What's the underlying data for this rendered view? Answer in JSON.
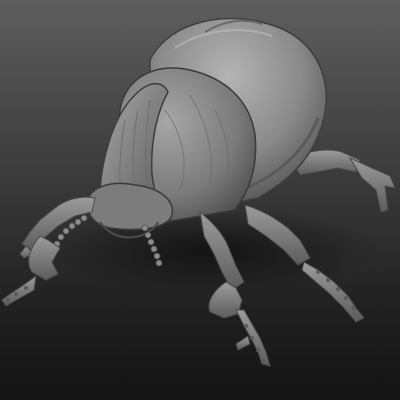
{
  "scene": {
    "subject": "beetle-sculpt",
    "material_color": "#8a8a8a",
    "shadow_color": "#3c3c3c",
    "highlight_color": "#c4c4c4",
    "background_top": "#5e5e5e",
    "background_bottom": "#141414"
  }
}
